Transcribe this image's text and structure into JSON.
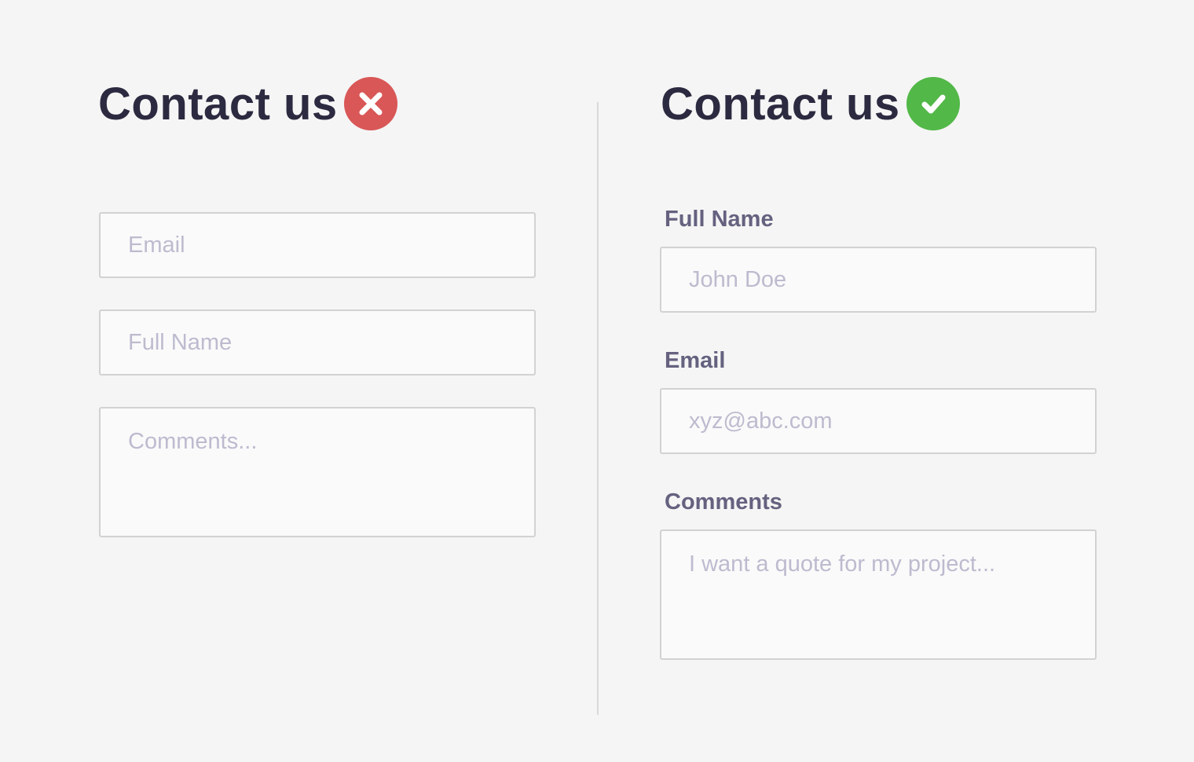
{
  "bad_form": {
    "title": "Contact us",
    "status_icon": "close-icon",
    "status_color": "#d95757",
    "fields": {
      "email_placeholder": "Email",
      "full_name_placeholder": "Full Name",
      "comments_placeholder": "Comments..."
    }
  },
  "good_form": {
    "title": "Contact us",
    "status_icon": "check-icon",
    "status_color": "#52b848",
    "fields": {
      "full_name_label": "Full Name",
      "full_name_placeholder": "John Doe",
      "email_label": "Email",
      "email_placeholder": "xyz@abc.com",
      "comments_label": "Comments",
      "comments_placeholder": "I want a quote for my project..."
    }
  },
  "colors": {
    "background": "#f5f5f5",
    "title_text": "#2b2a40",
    "label_text": "#64627f",
    "placeholder_text": "#bdbbcf",
    "field_border": "#d2d2d2"
  }
}
